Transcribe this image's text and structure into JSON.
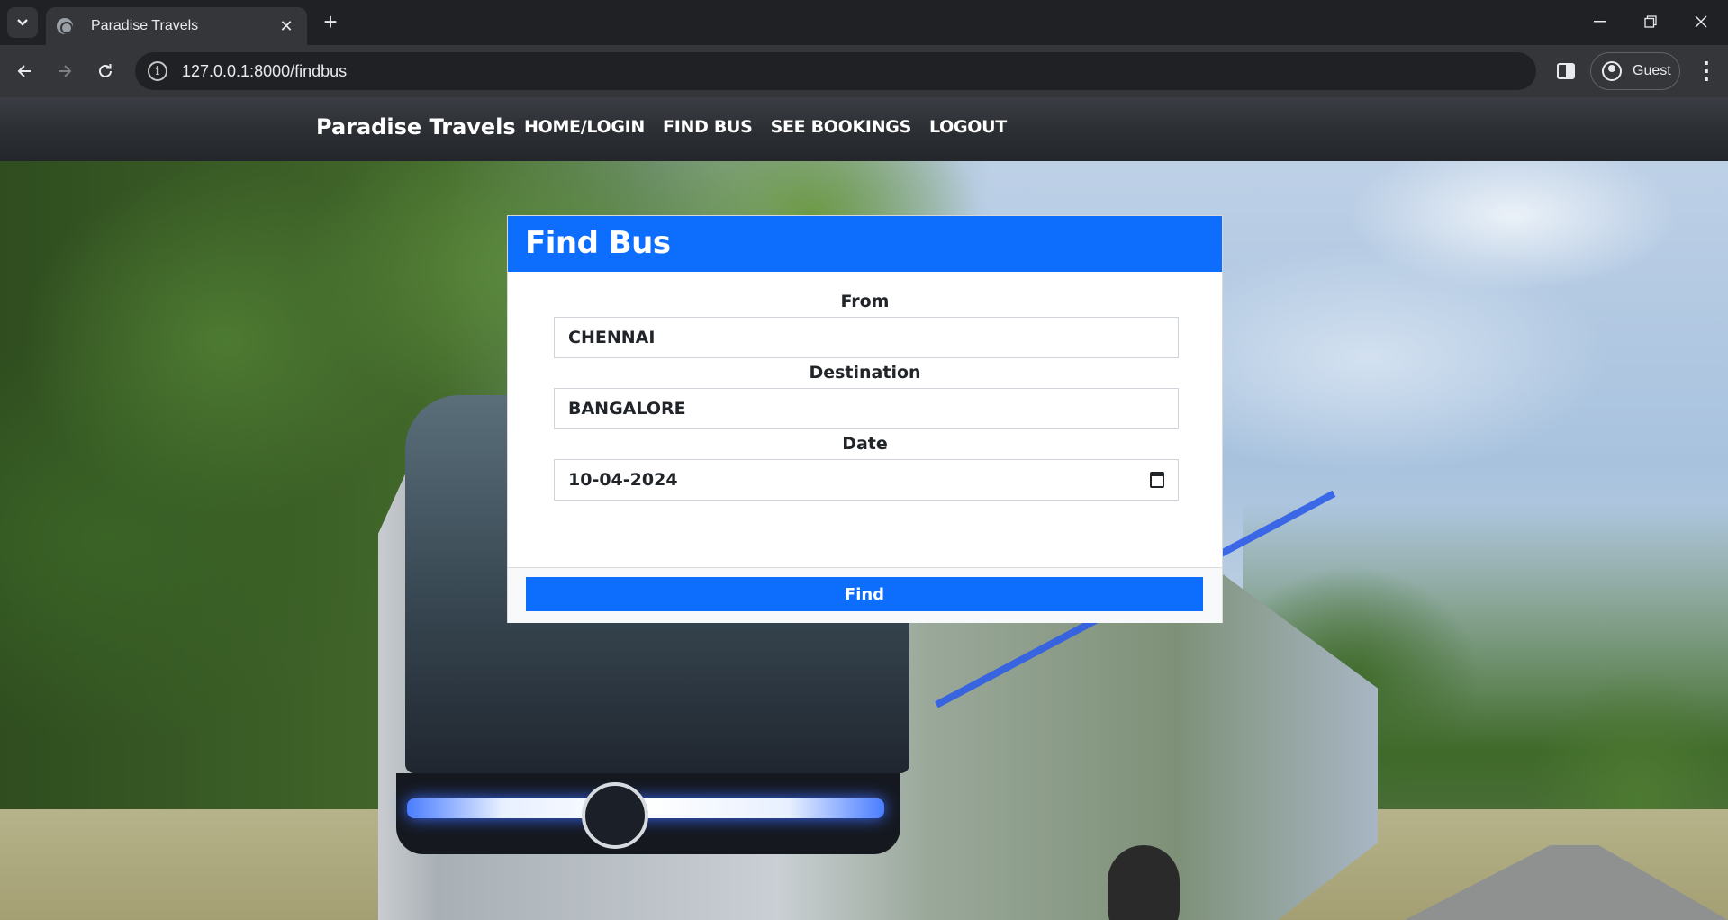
{
  "browser": {
    "tab_title": "Paradise Travels",
    "url": "127.0.0.1:8000/findbus",
    "profile_label": "Guest"
  },
  "navbar": {
    "brand": "Paradise Travels",
    "links": [
      "HOME/LOGIN",
      "FIND BUS",
      "SEE BOOKINGS",
      "LOGOUT"
    ]
  },
  "form": {
    "title": "Find Bus",
    "from_label": "From",
    "from_value": "CHENNAI",
    "destination_label": "Destination",
    "destination_value": "BANGALORE",
    "date_label": "Date",
    "date_value": "10-04-2024",
    "submit_label": "Find"
  },
  "colors": {
    "primary": "#0d6efd",
    "navbar": "#2c2f34"
  }
}
